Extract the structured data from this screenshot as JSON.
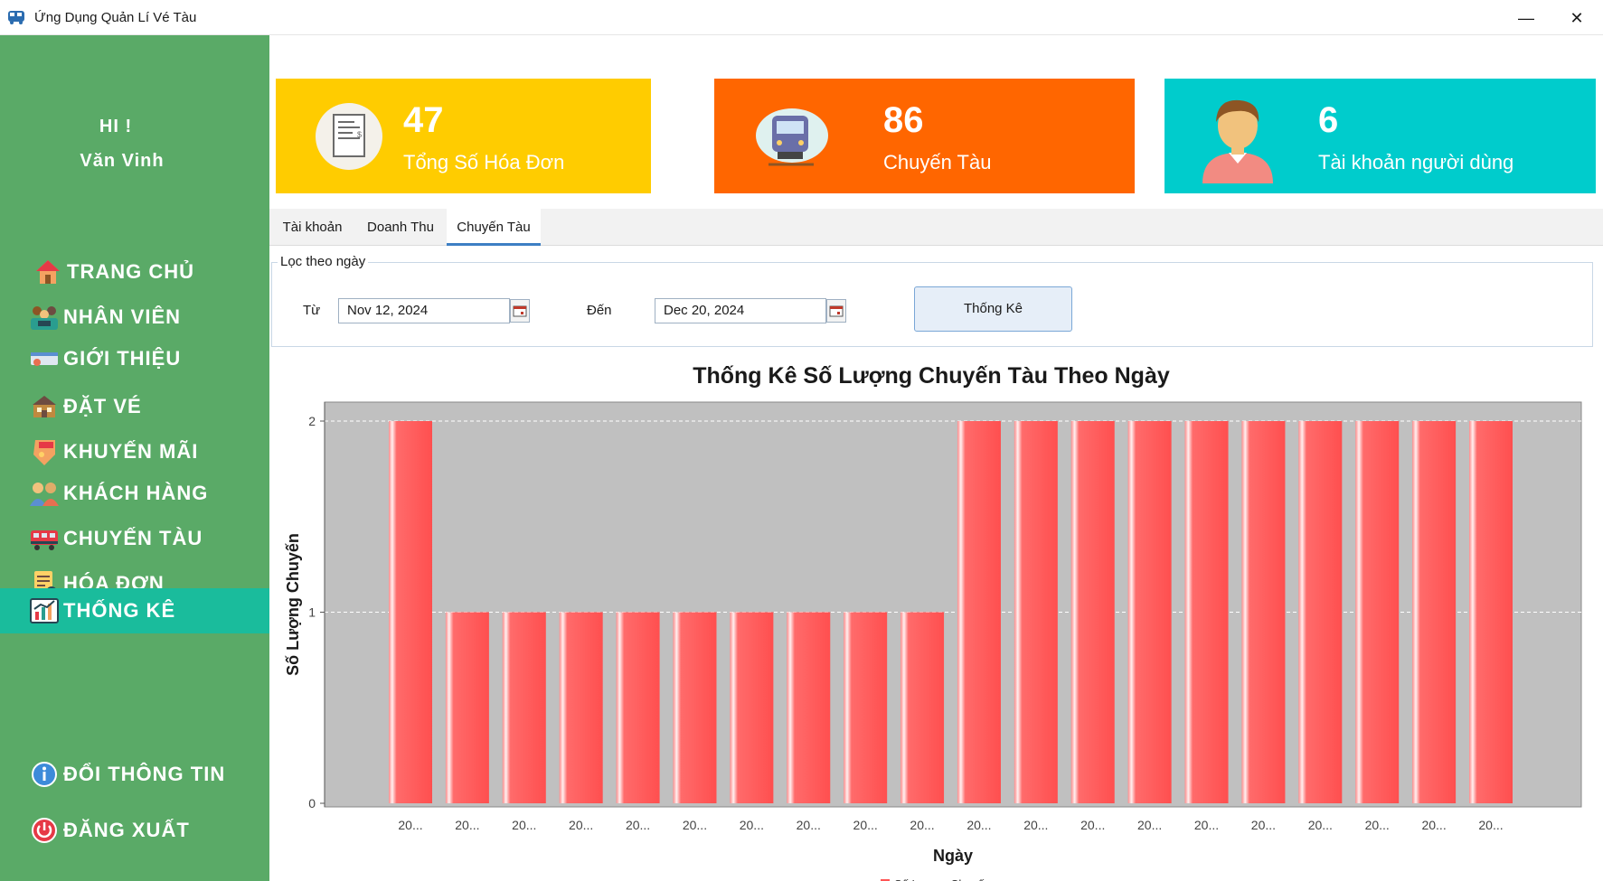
{
  "window": {
    "title": "Ứng Dụng Quản Lí Vé Tàu",
    "minimize": "—",
    "close": "✕"
  },
  "greeting": {
    "hi": "HI !",
    "name": "Văn Vinh"
  },
  "sidebar": {
    "items": [
      {
        "label": "TRANG CHỦ",
        "icon": "home-icon"
      },
      {
        "label": "NHÂN VIÊN",
        "icon": "staff-icon"
      },
      {
        "label": "GIỚI THIỆU",
        "icon": "intro-icon"
      },
      {
        "label": "ĐẶT VÉ",
        "icon": "ticket-icon"
      },
      {
        "label": "KHUYẾN MÃI",
        "icon": "sale-icon"
      },
      {
        "label": "KHÁCH HÀNG",
        "icon": "customer-icon"
      },
      {
        "label": "CHUYẾN TÀU",
        "icon": "train-icon"
      },
      {
        "label": "HÓA ĐƠN",
        "icon": "invoice-icon"
      },
      {
        "label": "THỐNG KÊ",
        "icon": "chart-icon",
        "active": true
      }
    ],
    "bottom": [
      {
        "label": "ĐỔI THÔNG TIN",
        "icon": "info-icon"
      },
      {
        "label": "ĐĂNG XUẤT",
        "icon": "power-icon"
      }
    ]
  },
  "cards": [
    {
      "value": "47",
      "caption": "Tổng Số Hóa Đơn",
      "color": "#ffcc00",
      "icon": "receipt-icon"
    },
    {
      "value": "86",
      "caption": "Chuyến Tàu",
      "color": "#ff6600",
      "icon": "train-icon"
    },
    {
      "value": "6",
      "caption": "Tài khoản người dùng",
      "color": "#00cccc",
      "icon": "user-icon"
    }
  ],
  "tabs": [
    {
      "label": "Tài khoản"
    },
    {
      "label": "Doanh Thu"
    },
    {
      "label": "Chuyến Tàu",
      "active": true
    }
  ],
  "filter": {
    "legend": "Lọc theo ngày",
    "from_label": "Từ",
    "from_value": "Nov 12, 2024",
    "to_label": "Đến",
    "to_value": "Dec 20, 2024",
    "button": "Thống Kê"
  },
  "chart_data": {
    "type": "bar",
    "title": "Thống Kê Số Lượng Chuyến Tàu Theo Ngày",
    "xlabel": "Ngày",
    "ylabel": "Số Lượng Chuyến",
    "categories": [
      "20...",
      "20...",
      "20...",
      "20...",
      "20...",
      "20...",
      "20...",
      "20...",
      "20...",
      "20...",
      "20...",
      "20...",
      "20...",
      "20...",
      "20...",
      "20...",
      "20...",
      "20...",
      "20...",
      "20..."
    ],
    "series": [
      {
        "name": "Số Lượng Chuyến",
        "values": [
          2,
          1,
          1,
          1,
          1,
          1,
          1,
          1,
          1,
          1,
          2,
          2,
          2,
          2,
          2,
          2,
          2,
          2,
          2,
          2
        ]
      }
    ],
    "ylim": [
      0,
      2
    ],
    "yticks": [
      0,
      1,
      2
    ],
    "grid": true,
    "legend": "bottom",
    "bar_color": "#ff5555",
    "plot_bg": "#c0c0c0"
  }
}
